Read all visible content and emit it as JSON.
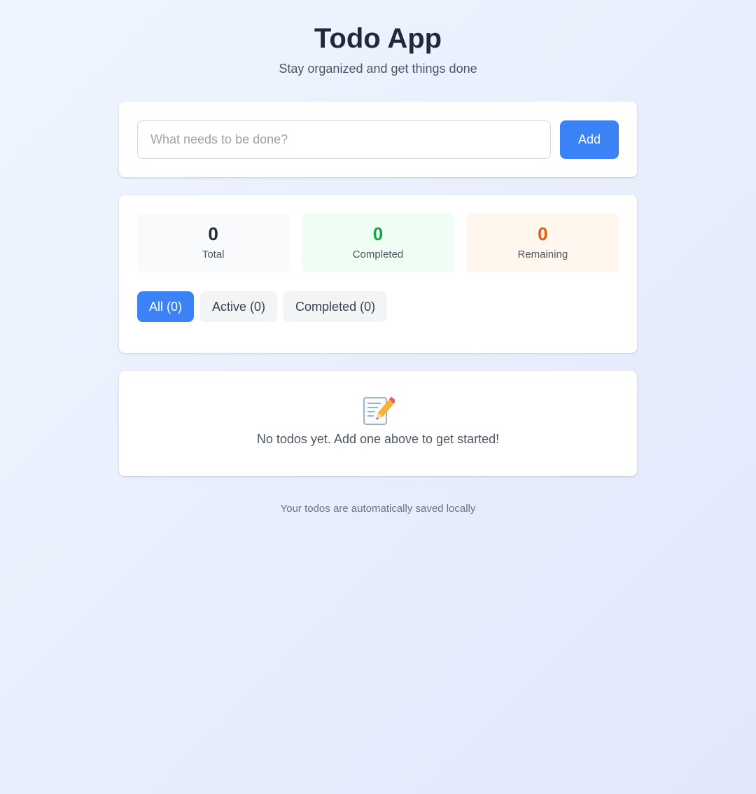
{
  "header": {
    "title": "Todo App",
    "subtitle": "Stay organized and get things done"
  },
  "add_form": {
    "input_value": "",
    "input_placeholder": "What needs to be done?",
    "add_label": "Add"
  },
  "stats": {
    "total": {
      "value": "0",
      "label": "Total"
    },
    "completed": {
      "value": "0",
      "label": "Completed"
    },
    "remaining": {
      "value": "0",
      "label": "Remaining"
    }
  },
  "filters": [
    {
      "label": "All (0)",
      "active": true
    },
    {
      "label": "Active (0)",
      "active": false
    },
    {
      "label": "Completed (0)",
      "active": false
    }
  ],
  "empty_state": {
    "icon": "memo-pencil-icon",
    "message": "No todos yet. Add one above to get started!"
  },
  "footer": {
    "note": "Your todos are automatically saved locally"
  },
  "colors": {
    "accent": "#3b82f6",
    "completed": "#16a34a",
    "remaining": "#ea580c"
  }
}
